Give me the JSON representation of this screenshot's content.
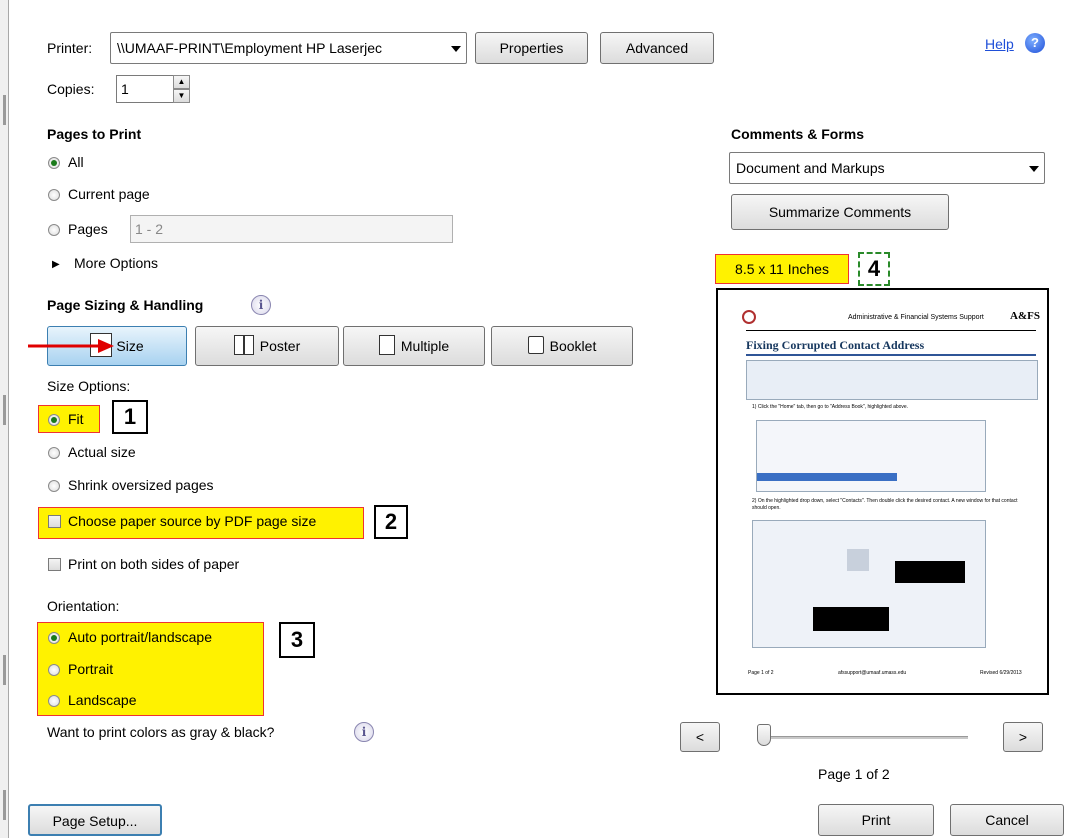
{
  "printer": {
    "label": "Printer:",
    "value": "\\\\UMAAF-PRINT\\Employment HP Laserjec",
    "properties_label": "Properties",
    "advanced_label": "Advanced"
  },
  "help_label": "Help",
  "copies": {
    "label": "Copies:",
    "value": "1"
  },
  "pages_to_print": {
    "heading": "Pages to Print",
    "options": [
      "All",
      "Current page",
      "Pages"
    ],
    "selected": "All",
    "pages_value": "1 - 2",
    "more_options": "More Options"
  },
  "page_sizing": {
    "heading": "Page Sizing & Handling",
    "modes": [
      "Size",
      "Poster",
      "Multiple",
      "Booklet"
    ],
    "selected_mode": "Size"
  },
  "size_options": {
    "heading": "Size Options:",
    "options": [
      "Fit",
      "Actual size",
      "Shrink oversized pages"
    ],
    "selected": "Fit",
    "paper_source": "Choose paper source by PDF page size",
    "both_sides": "Print on both sides of paper"
  },
  "orientation": {
    "heading": "Orientation:",
    "options": [
      "Auto portrait/landscape",
      "Portrait",
      "Landscape"
    ],
    "selected": "Auto portrait/landscape"
  },
  "gray_question": "Want to print colors as gray & black?",
  "comments_forms": {
    "heading": "Comments & Forms",
    "value": "Document and Markups",
    "summarize_label": "Summarize Comments"
  },
  "preview": {
    "size_label": "8.5 x 11 Inches",
    "doc_header": "Administrative & Financial Systems Support",
    "doc_logo": "A&FS",
    "doc_title": "Fixing Corrupted Contact Address",
    "step1": "1)   Click the \"Home\" tab, then go to \"Address Book\", highlighted above.",
    "step2": "2)   On the highlighted drop down, select \"Contacts\". Then double click the desired contact. A new window for that contact should open.",
    "footer_left": "Page 1 of 2",
    "footer_mid": "afssupport@umaaf.umass.edu",
    "footer_right": "Revised 6/29/2013",
    "page_indicator": "Page 1 of 2",
    "prev_label": "<",
    "next_label": ">",
    "page_fraction": 0.0
  },
  "annotations": [
    "1",
    "2",
    "3",
    "4"
  ],
  "footer": {
    "page_setup_label": "Page Setup...",
    "print_label": "Print",
    "cancel_label": "Cancel"
  },
  "colors": {
    "highlight": "#fff200",
    "highlight_border": "#e33333",
    "link": "#1f4fd8",
    "arrow": "#e00000"
  }
}
